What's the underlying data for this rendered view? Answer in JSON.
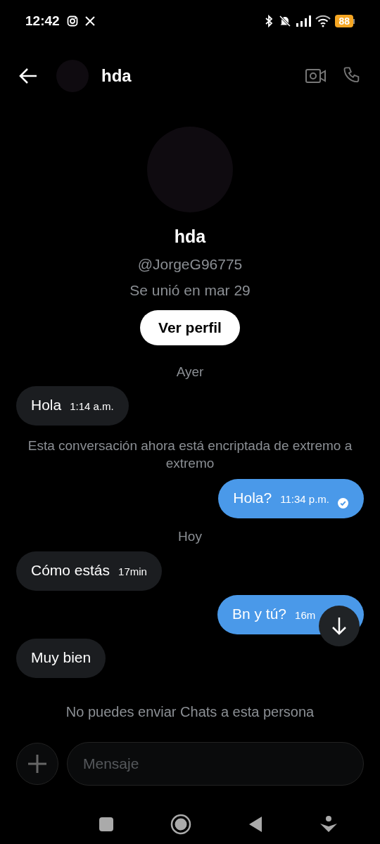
{
  "status_bar": {
    "time": "12:42",
    "battery": "88"
  },
  "header": {
    "title": "hda"
  },
  "profile": {
    "name": "hda",
    "handle": "@JorgeG96775",
    "joined": "Se unió en mar 29",
    "button": "Ver perfil"
  },
  "messages": [
    {
      "kind": "date",
      "text": "Ayer"
    },
    {
      "kind": "incoming",
      "text": "Hola",
      "time": "1:14 a.m."
    },
    {
      "kind": "system",
      "text": "Esta conversación ahora está encriptada de extremo a extremo"
    },
    {
      "kind": "outgoing",
      "text": "Hola?",
      "time": "11:34 p.m.",
      "read": true
    },
    {
      "kind": "date",
      "text": "Hoy"
    },
    {
      "kind": "incoming",
      "text": "Cómo estás",
      "time": "17min"
    },
    {
      "kind": "outgoing",
      "text": "Bn y tú?",
      "time": "16m"
    },
    {
      "kind": "incoming",
      "text": "Muy bien"
    }
  ],
  "notice": "No puedes enviar Chats a esta persona",
  "composer": {
    "placeholder": "Mensaje"
  }
}
